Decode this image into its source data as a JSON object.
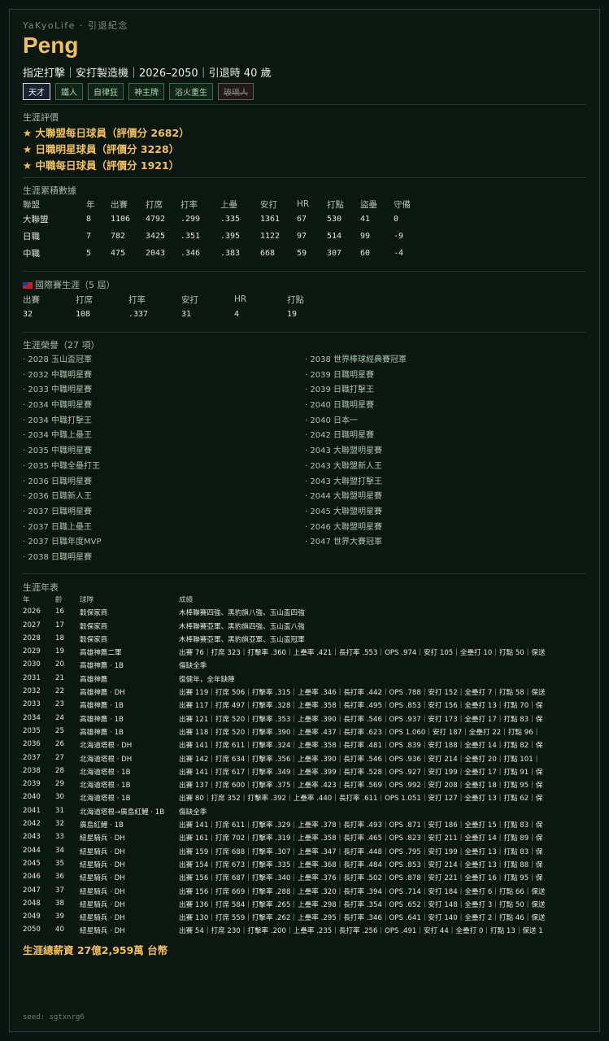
{
  "brand": "YaKyoLife · 引退紀念",
  "player_name": "Peng",
  "subtitle": "指定打擊｜安打製造機｜2026–2050｜引退時 40 歲",
  "tags": [
    "天才",
    "鐵人",
    "自律狂",
    "神主牌",
    "浴火重生",
    "玻璃人"
  ],
  "evaluation": {
    "title": "生涯評價",
    "awards": [
      "★ 大聯盟每日球員（評價分 2682）",
      "★ 日職明星球員（評價分 3228）",
      "★ 中職每日球員（評價分 1921）"
    ]
  },
  "career_stats": {
    "title": "生涯累積數據",
    "headers": [
      "聯盟",
      "年",
      "出賽",
      "打席",
      "打率",
      "上壘",
      "安打",
      "HR",
      "打點",
      "盜壘",
      "守備"
    ],
    "rows": [
      [
        "大聯盟",
        "8",
        "1106",
        "4792",
        ".299",
        ".335",
        "1361",
        "67",
        "530",
        "41",
        "0"
      ],
      [
        "日職",
        "7",
        "782",
        "3425",
        ".351",
        ".395",
        "1122",
        "97",
        "514",
        "99",
        "-9"
      ],
      [
        "中職",
        "5",
        "475",
        "2043",
        ".346",
        ".383",
        "668",
        "59",
        "307",
        "60",
        "-4"
      ]
    ]
  },
  "international": {
    "title": "國際賽生涯（5 屆）",
    "headers": [
      "出賽",
      "打席",
      "打率",
      "安打",
      "HR",
      "打點"
    ],
    "values": [
      "32",
      "108",
      ".337",
      "31",
      "4",
      "19"
    ]
  },
  "honors": {
    "title": "生涯榮譽（27 項）",
    "left": [
      "· 2028 玉山盃冠軍",
      "· 2032 中職明星賽",
      "· 2033 中職明星賽",
      "· 2034 中職明星賽",
      "· 2034 中職打擊王",
      "· 2034 中職上壘王",
      "· 2035 中職明星賽",
      "· 2035 中職全壘打王",
      "· 2036 日職明星賽",
      "· 2036 日職新人王",
      "· 2037 日職明星賽",
      "· 2037 日職上壘王",
      "· 2037 日職年度MVP",
      "· 2038 日職明星賽"
    ],
    "right": [
      "· 2038 世界棒球經典賽冠軍",
      "· 2039 日職明星賽",
      "· 2039 日職打擊王",
      "· 2040 日職明星賽",
      "· 2040 日本一",
      "· 2042 日職明星賽",
      "· 2043 大聯盟明星賽",
      "· 2043 大聯盟新人王",
      "· 2043 大聯盟打擊王",
      "· 2044 大聯盟明星賽",
      "· 2045 大聯盟明星賽",
      "· 2046 大聯盟明星賽",
      "· 2047 世界大賽冠軍"
    ]
  },
  "timeline": {
    "title": "生涯年表",
    "headers": [
      "年",
      "齡",
      "球隊",
      "成績"
    ],
    "rows": [
      [
        "2026",
        "16",
        "穀保家商",
        "木棒聯賽四強、黑豹旗八強、玉山盃四強"
      ],
      [
        "2027",
        "17",
        "穀保家商",
        "木棒聯賽亞軍、黑豹旗四強、玉山盃八強"
      ],
      [
        "2028",
        "18",
        "穀保家商",
        "木棒聯賽亞軍、黑豹旗亞軍、玉山盃冠軍"
      ],
      [
        "2029",
        "19",
        "高雄神鷹二軍",
        "出賽 76｜打席 323｜打擊率 .360｜上壘率 .421｜長打率 .553｜OPS .974｜安打 105｜全壘打 10｜打點 50｜保送"
      ],
      [
        "2030",
        "20",
        "高雄神鷹 · 1B",
        "傷缺全季"
      ],
      [
        "2031",
        "21",
        "高雄神鷹",
        "復健年，全年缺陣"
      ],
      [
        "2032",
        "22",
        "高雄神鷹 · DH",
        "出賽 119｜打席 506｜打擊率 .315｜上壘率 .346｜長打率 .442｜OPS .788｜安打 152｜全壘打 7｜打點 58｜保送"
      ],
      [
        "2033",
        "23",
        "高雄神鷹 · 1B",
        "出賽 117｜打席 497｜打擊率 .328｜上壘率 .358｜長打率 .495｜OPS .853｜安打 156｜全壘打 13｜打點 70｜保"
      ],
      [
        "2034",
        "24",
        "高雄神鷹 · 1B",
        "出賽 121｜打席 520｜打擊率 .353｜上壘率 .390｜長打率 .546｜OPS .937｜安打 173｜全壘打 17｜打點 83｜保"
      ],
      [
        "2035",
        "25",
        "高雄神鷹 · 1B",
        "出賽 118｜打席 520｜打擊率 .390｜上壘率 .437｜長打率 .623｜OPS 1.060｜安打 187｜全壘打 22｜打點 96｜"
      ],
      [
        "2036",
        "26",
        "北海道塔根 · DH",
        "出賽 141｜打席 611｜打擊率 .324｜上壘率 .358｜長打率 .481｜OPS .839｜安打 188｜全壘打 14｜打點 82｜保"
      ],
      [
        "2037",
        "27",
        "北海道塔根 · DH",
        "出賽 142｜打席 634｜打擊率 .356｜上壘率 .390｜長打率 .546｜OPS .936｜安打 214｜全壘打 20｜打點 101｜"
      ],
      [
        "2038",
        "28",
        "北海道塔根 · 1B",
        "出賽 141｜打席 617｜打擊率 .349｜上壘率 .399｜長打率 .528｜OPS .927｜安打 199｜全壘打 17｜打點 91｜保"
      ],
      [
        "2039",
        "29",
        "北海道塔根 · 1B",
        "出賽 137｜打席 600｜打擊率 .375｜上壘率 .423｜長打率 .569｜OPS .992｜安打 208｜全壘打 18｜打點 95｜保"
      ],
      [
        "2040",
        "30",
        "北海道塔根 · 1B",
        "出賽 80｜打席 352｜打擊率 .392｜上壘率 .440｜長打率 .611｜OPS 1.051｜安打 127｜全壘打 13｜打點 62｜保"
      ],
      [
        "2041",
        "31",
        "北海道塔根→廣島紅鯉 · 1B",
        "傷缺全季"
      ],
      [
        "2042",
        "32",
        "廣島紅鯉 · 1B",
        "出賽 141｜打席 611｜打擊率 .329｜上壘率 .378｜長打率 .493｜OPS .871｜安打 186｜全壘打 15｜打點 83｜保"
      ],
      [
        "2043",
        "33",
        "紐星騎兵 · DH",
        "出賽 161｜打席 702｜打擊率 .319｜上壘率 .358｜長打率 .465｜OPS .823｜安打 211｜全壘打 14｜打點 89｜保"
      ],
      [
        "2044",
        "34",
        "紐星騎兵 · DH",
        "出賽 159｜打席 688｜打擊率 .307｜上壘率 .347｜長打率 .448｜OPS .795｜安打 199｜全壘打 13｜打點 83｜保"
      ],
      [
        "2045",
        "35",
        "紐星騎兵 · DH",
        "出賽 154｜打席 673｜打擊率 .335｜上壘率 .368｜長打率 .484｜OPS .853｜安打 214｜全壘打 13｜打點 88｜保"
      ],
      [
        "2046",
        "36",
        "紐星騎兵 · DH",
        "出賽 156｜打席 687｜打擊率 .340｜上壘率 .376｜長打率 .502｜OPS .878｜安打 221｜全壘打 16｜打點 95｜保"
      ],
      [
        "2047",
        "37",
        "紐星騎兵 · DH",
        "出賽 156｜打席 669｜打擊率 .288｜上壘率 .320｜長打率 .394｜OPS .714｜安打 184｜全壘打 6｜打點 66｜保送"
      ],
      [
        "2048",
        "38",
        "紐星騎兵 · DH",
        "出賽 136｜打席 584｜打擊率 .265｜上壘率 .298｜長打率 .354｜OPS .652｜安打 148｜全壘打 3｜打點 50｜保送"
      ],
      [
        "2049",
        "39",
        "紐星騎兵 · DH",
        "出賽 130｜打席 559｜打擊率 .262｜上壘率 .295｜長打率 .346｜OPS .641｜安打 140｜全壘打 2｜打點 46｜保送"
      ],
      [
        "2050",
        "40",
        "紐星騎兵 · DH",
        "出賽 54｜打席 230｜打擊率 .200｜上壘率 .235｜長打率 .256｜OPS .491｜安打 44｜全壘打 0｜打點 13｜保送 1"
      ]
    ]
  },
  "salary": "生涯總薪資 27億2,959萬 台幣",
  "seed": "seed: sgtxnrg6"
}
